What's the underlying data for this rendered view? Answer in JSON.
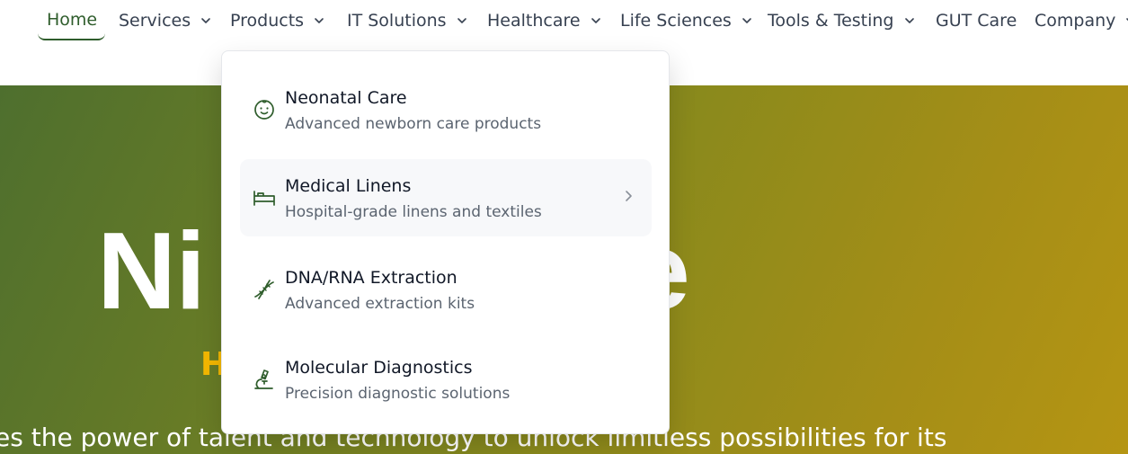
{
  "nav": {
    "items": [
      {
        "label": "Home",
        "active": true,
        "has_dropdown": false
      },
      {
        "label": "Services",
        "has_dropdown": true
      },
      {
        "label": "Products",
        "has_dropdown": true
      },
      {
        "label": "IT Solutions",
        "has_dropdown": true
      },
      {
        "label": "Healthcare",
        "has_dropdown": true
      },
      {
        "label": "Life Sciences",
        "has_dropdown": true
      },
      {
        "label": "Tools & Testing",
        "has_dropdown": true
      },
      {
        "label": "GUT Care",
        "has_dropdown": false
      },
      {
        "label": "Company",
        "has_dropdown": true
      }
    ],
    "accent_color": "#2f5d2c"
  },
  "hero": {
    "title_fragment": "Ni",
    "title_fragment_right": "e",
    "subtitle_fragment": "H",
    "text": "es the power of talent and technology to unlock limitless possibilities for its",
    "subtitle_color": "#f5b800"
  },
  "products_menu": {
    "items": [
      {
        "title": "Neonatal Care",
        "description": "Advanced newborn care products",
        "icon": "baby-face-icon"
      },
      {
        "title": "Medical Linens",
        "description": "Hospital-grade linens and textiles",
        "icon": "bed-icon",
        "hovered": true,
        "has_submenu": true
      },
      {
        "title": "DNA/RNA Extraction",
        "description": "Advanced extraction kits",
        "icon": "dna-icon"
      },
      {
        "title": "Molecular Diagnostics",
        "description": "Precision diagnostic solutions",
        "icon": "microscope-icon"
      }
    ]
  }
}
